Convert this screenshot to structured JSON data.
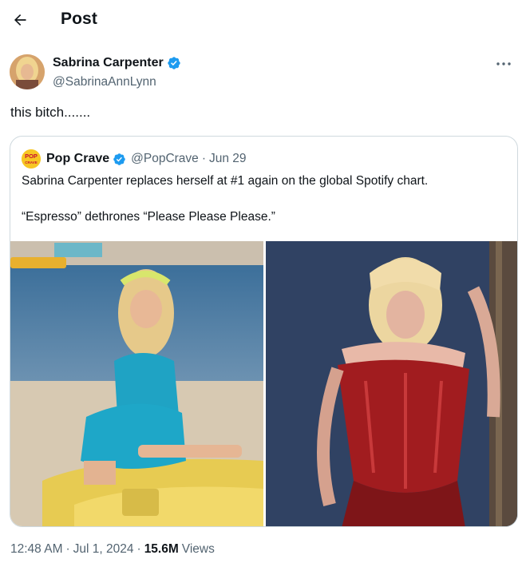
{
  "header": {
    "title": "Post"
  },
  "author": {
    "name": "Sabrina Carpenter",
    "handle": "@SabrinaAnnLynn",
    "verified": true
  },
  "tweet": {
    "text": "this bitch......."
  },
  "quoted": {
    "name": "Pop Crave",
    "logo_text": [
      "POP",
      "CRAVE"
    ],
    "handle": "@PopCrave",
    "separator": "·",
    "date": "Jun 29",
    "line1": "Sabrina Carpenter replaces herself at #1 again on the global Spotify chart.",
    "line2": "“Espresso” dethrones “Please Please Please.”"
  },
  "footer": {
    "time": "12:48 AM",
    "sep1": "·",
    "date": "Jul 1, 2024",
    "sep2": "·",
    "views_count": "15.6M",
    "views_label": "Views"
  },
  "colors": {
    "verified": "#1d9bf0",
    "secondary_text": "#536471",
    "border": "#cfd9de"
  },
  "icons": [
    "back-arrow-icon",
    "verified-badge-icon",
    "more-icon"
  ]
}
